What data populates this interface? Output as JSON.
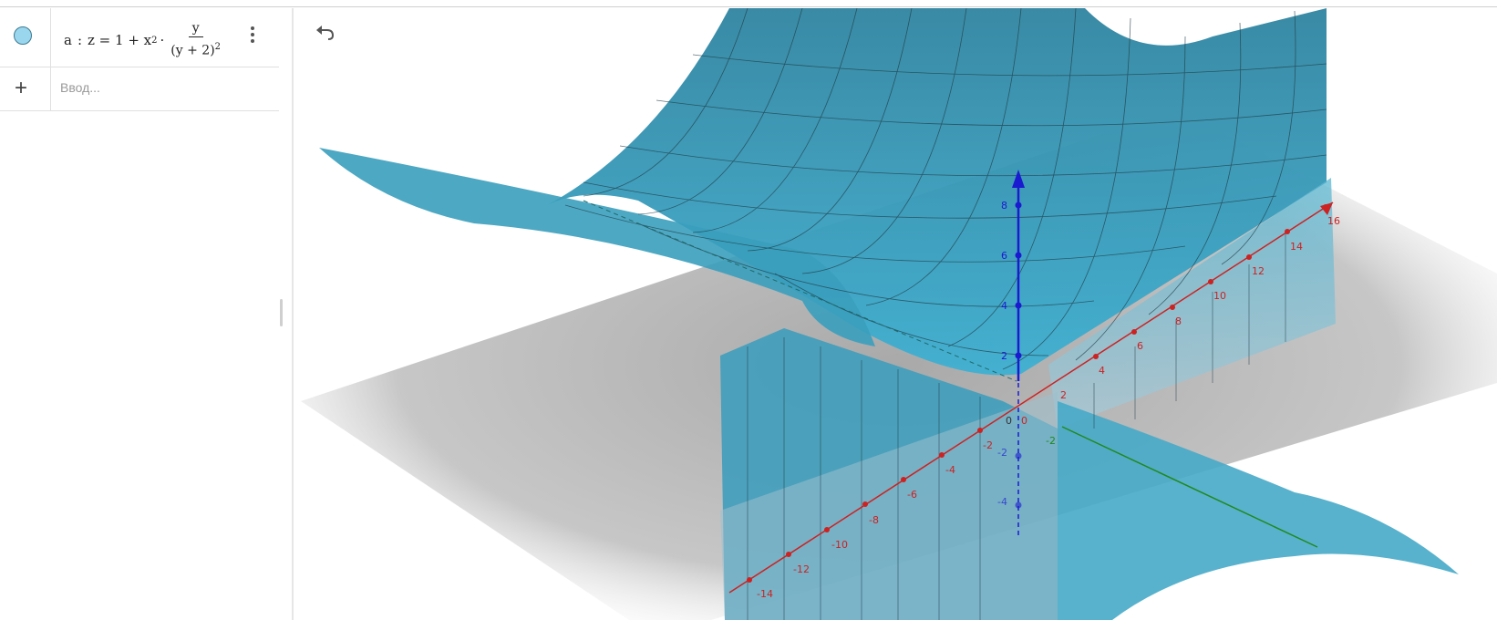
{
  "algebra": {
    "formula": {
      "label": "a",
      "sep": ":",
      "lhs": "z = 1 + x",
      "exp": "2",
      "dot": "·",
      "numerator": "y",
      "denominator": "(y + 2)",
      "den_exp": "2"
    },
    "input_placeholder": "Ввод..."
  },
  "view3d": {
    "x_ticks": [
      "-14",
      "-12",
      "-10",
      "-8",
      "-6",
      "-4",
      "-2",
      "0",
      "2",
      "4",
      "6",
      "8",
      "10",
      "12",
      "14",
      "16"
    ],
    "z_ticks_pos": [
      "2",
      "4",
      "6",
      "8"
    ],
    "z_ticks_neg": [
      "-2",
      "-4"
    ],
    "y_ticks": [
      "-2",
      "0"
    ]
  },
  "colors": {
    "surface": "#3aa7c7",
    "surface_dark": "#2f8aa8",
    "x_axis": "#cc2222",
    "z_axis": "#1a1ad1",
    "y_axis": "#1f8a1f"
  }
}
